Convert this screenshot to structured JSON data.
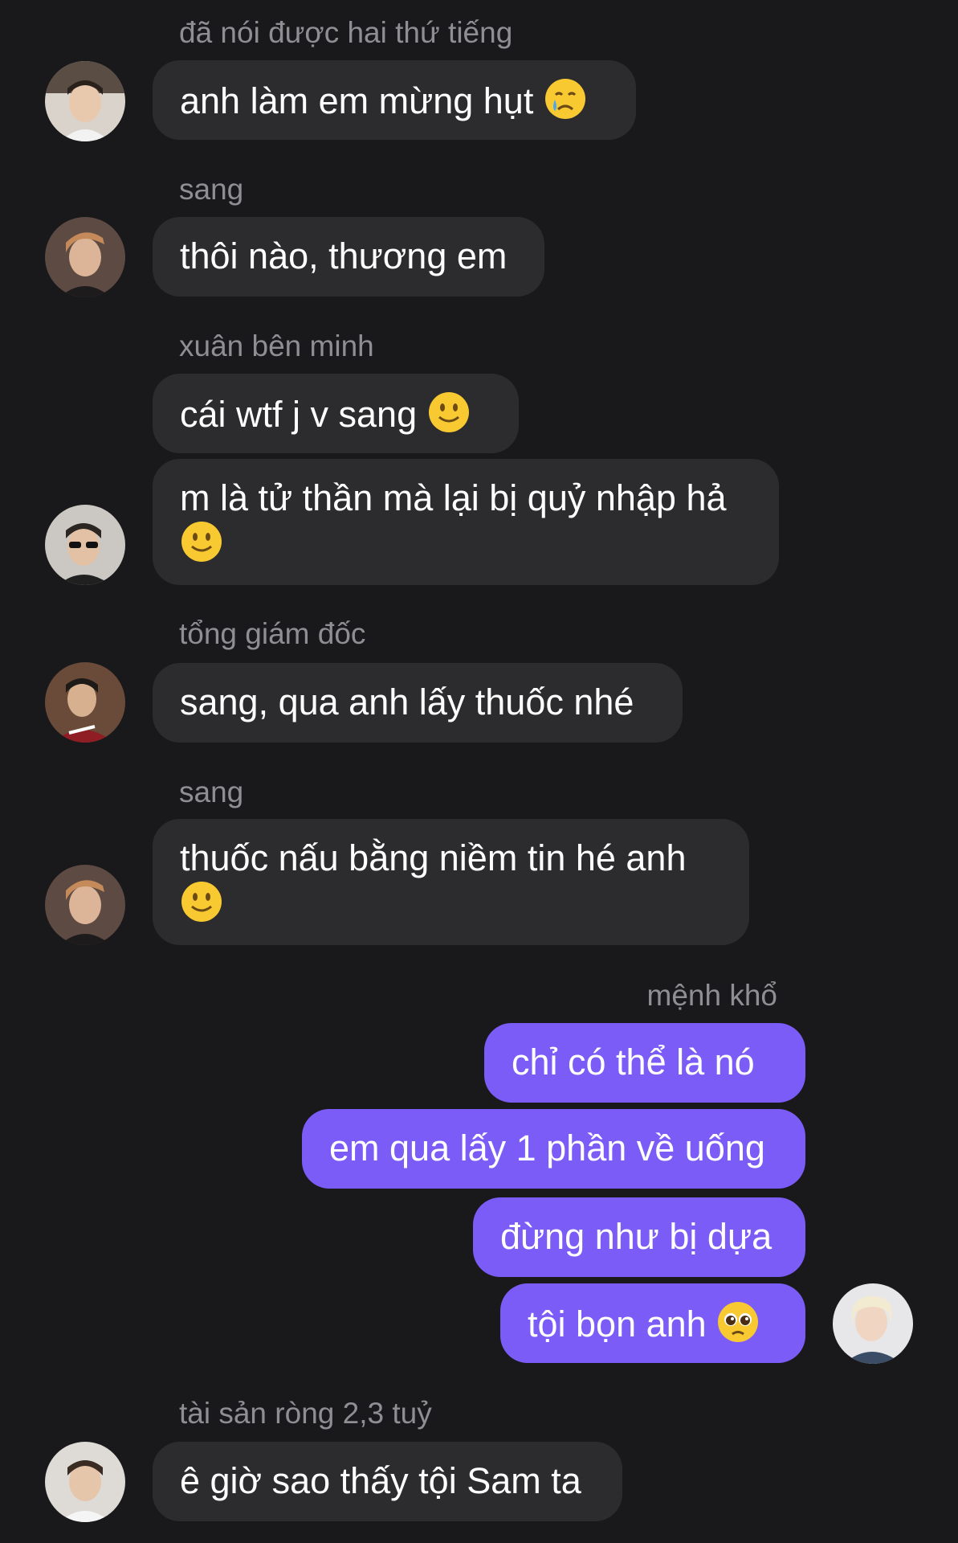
{
  "messages": [
    {
      "sender": "đã nói được hai thứ tiếng",
      "text": "anh làm em mừng hụt",
      "emoji": "crying-face-icon"
    },
    {
      "sender": "sang",
      "text": "thôi nào, thương em"
    },
    {
      "sender": "xuân bên minh",
      "text": "cái wtf j v sang",
      "emoji": "slightly-smiling-face-icon"
    },
    {
      "text": "m là tử thần mà lại bị quỷ nhập hả",
      "emoji": "slightly-smiling-face-icon"
    },
    {
      "sender": "tổng giám đốc",
      "text": "sang, qua anh lấy thuốc nhé"
    },
    {
      "sender": "sang",
      "text": "thuốc nấu bằng niềm tin hé anh",
      "emoji": "slightly-smiling-face-icon"
    },
    {
      "sender": "mệnh khổ",
      "text": "chỉ có thể là nó"
    },
    {
      "text": "em qua lấy 1 phần về uống"
    },
    {
      "text": "đừng như bị dựa"
    },
    {
      "text": "tội bọn anh",
      "emoji": "pleading-face-icon"
    },
    {
      "sender": "tài sản ròng 2,3 tuỷ",
      "text": "ê giờ sao thấy tội Sam ta"
    }
  ],
  "colors": {
    "background": "#19191b",
    "incoming_bubble": "#2c2c2e",
    "outgoing_bubble": "#7c5cf7",
    "sender_name": "#8e8e93",
    "message_text": "#ffffff"
  }
}
